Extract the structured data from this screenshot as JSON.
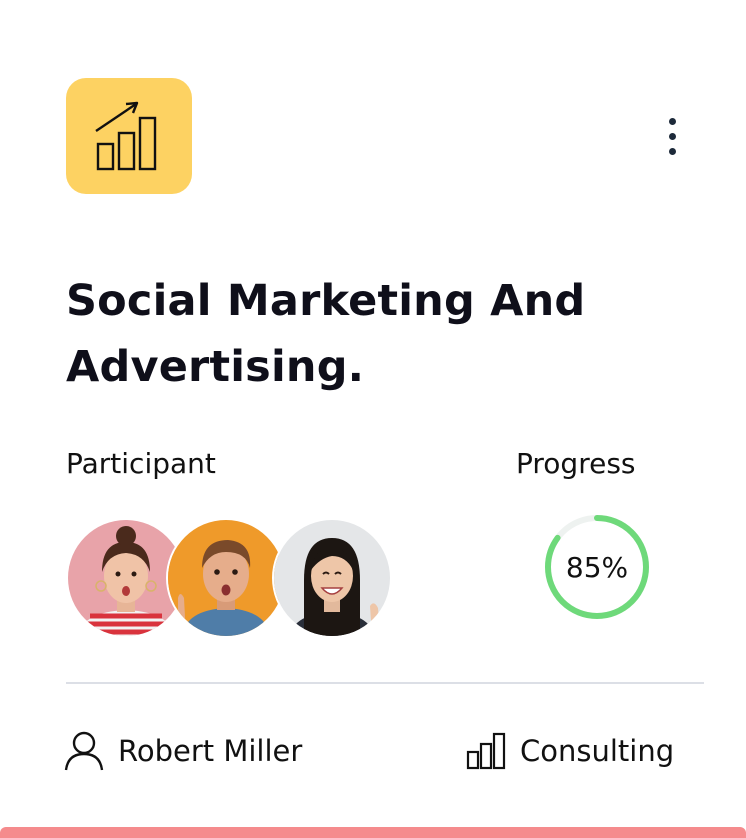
{
  "card": {
    "title": "Social Marketing And Advertising.",
    "icon": "chart-growth-icon",
    "accent_color": "#fdd262",
    "bottom_bar_color": "#f58b8d"
  },
  "participants": {
    "label": "Participant",
    "avatars": [
      "participant-1-avatar",
      "participant-2-avatar",
      "participant-3-avatar"
    ]
  },
  "progress": {
    "label": "Progress",
    "value": 85,
    "value_text": "85%",
    "color": "#6ed97a"
  },
  "footer": {
    "owner": "Robert Miller",
    "category": "Consulting"
  }
}
